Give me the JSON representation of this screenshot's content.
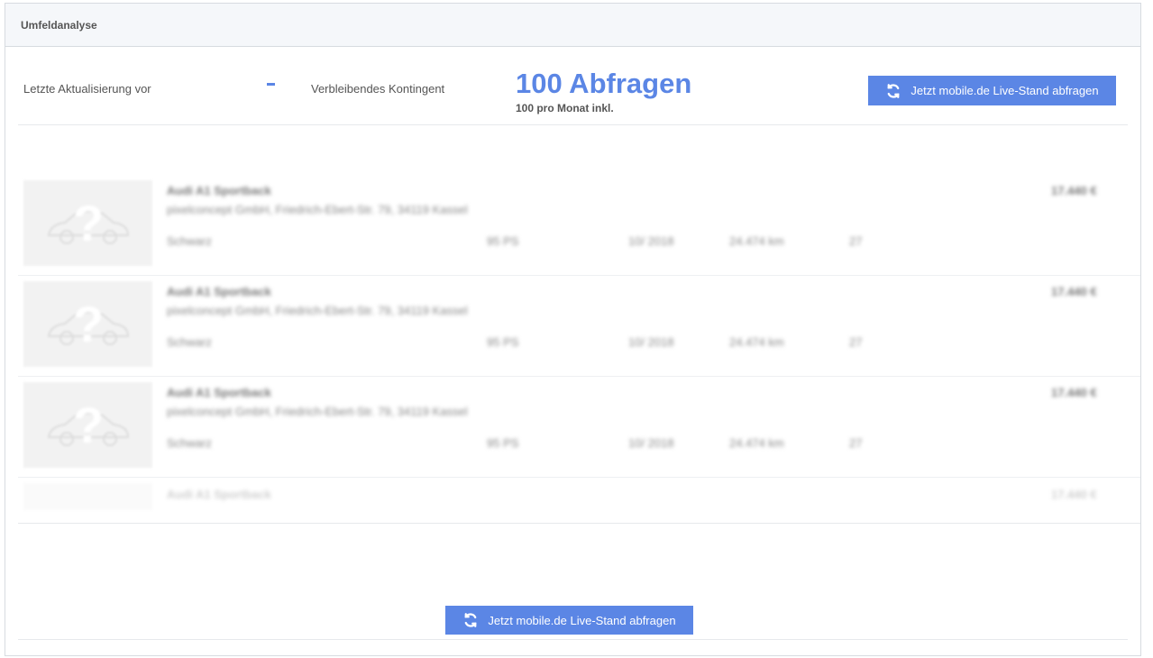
{
  "panel": {
    "title": "Umfeldanalyse"
  },
  "info": {
    "last_update_label": "Letzte Aktualisierung vor",
    "last_update_value": "-",
    "quota_label": "Verbleibendes Kontingent",
    "quota_value": "100 Abfragen",
    "quota_note": "100 pro Monat inkl."
  },
  "actions": {
    "refresh_label": "Jetzt mobile.de Live-Stand abfragen",
    "refresh_icon": "refresh-icon"
  },
  "listings": [
    {
      "title": "Audi A1 Sportback",
      "dealer": "pixelconcept GmbH, Friedrich-Ebert-Str. 79, 34119 Kassel",
      "color": "Schwarz",
      "power": "95 PS",
      "registration": "10/ 2018",
      "mileage": "24.474 km",
      "days": "27",
      "price": "17.440 €"
    },
    {
      "title": "Audi A1 Sportback",
      "dealer": "pixelconcept GmbH, Friedrich-Ebert-Str. 79, 34119 Kassel",
      "color": "Schwarz",
      "power": "95 PS",
      "registration": "10/ 2018",
      "mileage": "24.474 km",
      "days": "27",
      "price": "17.440 €"
    },
    {
      "title": "Audi A1 Sportback",
      "dealer": "pixelconcept GmbH, Friedrich-Ebert-Str. 79, 34119 Kassel",
      "color": "Schwarz",
      "power": "95 PS",
      "registration": "10/ 2018",
      "mileage": "24.474 km",
      "days": "27",
      "price": "17.440 €"
    },
    {
      "title": "Audi A1 Sportback",
      "price": "17.440 €"
    }
  ],
  "colors": {
    "accent": "#5b86e5",
    "header_bg": "#f5f7fa",
    "border": "#d7dbe0"
  }
}
